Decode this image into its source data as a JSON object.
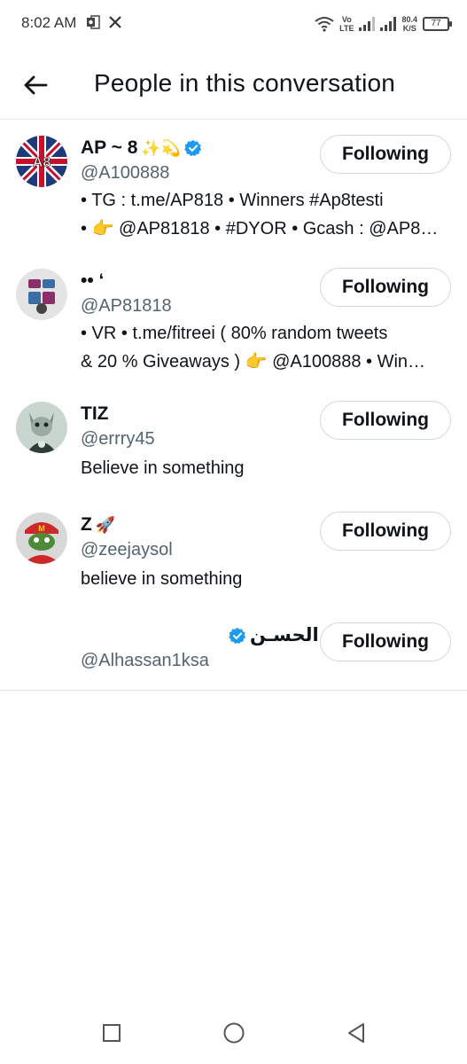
{
  "status_bar": {
    "time": "8:02 AM",
    "network_top": "Vo",
    "network_bottom": "LTE",
    "speed_top": "80.4",
    "speed_bottom": "K/S",
    "battery": "77"
  },
  "header": {
    "title": "People in this conversation",
    "back_icon": "arrow-left-icon"
  },
  "users": [
    {
      "name": "AP ~ 8",
      "name_emoji": "✨💫",
      "verified": true,
      "handle": "@A100888",
      "bio_lines": [
        "• TG : t.me/AP818 • Winners #Ap8testi",
        "• 👉 @AP81818 • #DYOR • Gcash : @AP8…"
      ],
      "button": "Following",
      "avatar_colors": [
        "#1f3a7a",
        "#c8102e"
      ]
    },
    {
      "name": "•• ‘",
      "name_emoji": "",
      "verified": false,
      "handle": "@AP81818",
      "bio_lines": [
        "• VR • t.me/fitreei ( 80% random tweets",
        "& 20 % Giveaways ) 👉 @A100888 • Win…"
      ],
      "button": "Following",
      "avatar_colors": [
        "#d9d9d9",
        "#8a2f6b"
      ]
    },
    {
      "name": "TIZ",
      "name_emoji": "",
      "verified": false,
      "handle": "@errry45",
      "bio_lines": [
        "Believe in something"
      ],
      "button": "Following",
      "avatar_colors": [
        "#b9c7c0",
        "#3b4a44"
      ]
    },
    {
      "name": "Z",
      "name_emoji": "🚀",
      "verified": false,
      "handle": "@zeejaysol",
      "bio_lines": [
        "believe in something"
      ],
      "button": "Following",
      "avatar_colors": [
        "#cc2a2a",
        "#4f8a3a"
      ]
    },
    {
      "name": "الحسـن",
      "name_emoji": "",
      "verified": true,
      "handle": "@Alhassan1ksa",
      "bio_lines": [],
      "button": "Following",
      "avatar_colors": [
        "#ffffff",
        "#ffffff"
      ]
    }
  ],
  "nav_bar": {
    "recents_icon": "square-icon",
    "home_icon": "circle-icon",
    "back_icon": "triangle-back-icon"
  },
  "colors": {
    "text_primary": "#0f1419",
    "text_secondary": "#536471",
    "verified_blue": "#1d9bf0",
    "border": "#cfd9de"
  }
}
